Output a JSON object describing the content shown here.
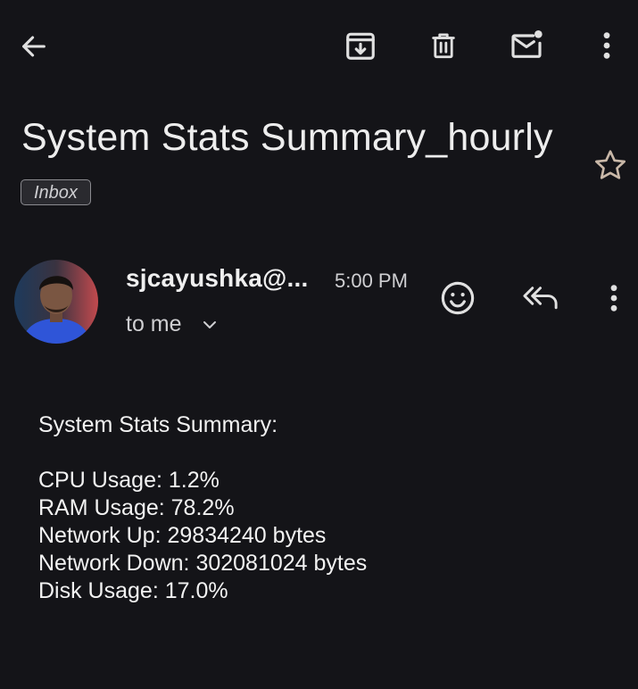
{
  "toolbar": {
    "back": "back-arrow-icon",
    "archive": "archive-icon",
    "delete": "trash-icon",
    "mark_unread": "mark-unread-icon",
    "more": "more-vert-icon"
  },
  "email": {
    "subject": "System Stats Summary_hourly",
    "label": "Inbox",
    "sender": "sjcayushka@...",
    "time": "5:00 PM",
    "recipient": "to me",
    "body_heading": "System Stats Summary:",
    "body_lines": [
      "CPU Usage: 1.2%",
      "RAM Usage: 78.2%",
      "Network Up: 29834240 bytes",
      "Network Down: 302081024 bytes",
      "Disk Usage: 17.0%"
    ]
  },
  "colors": {
    "background": "#141418",
    "text": "#ededed",
    "icon": "#e0e0e0",
    "star": "#c9b8a8"
  }
}
